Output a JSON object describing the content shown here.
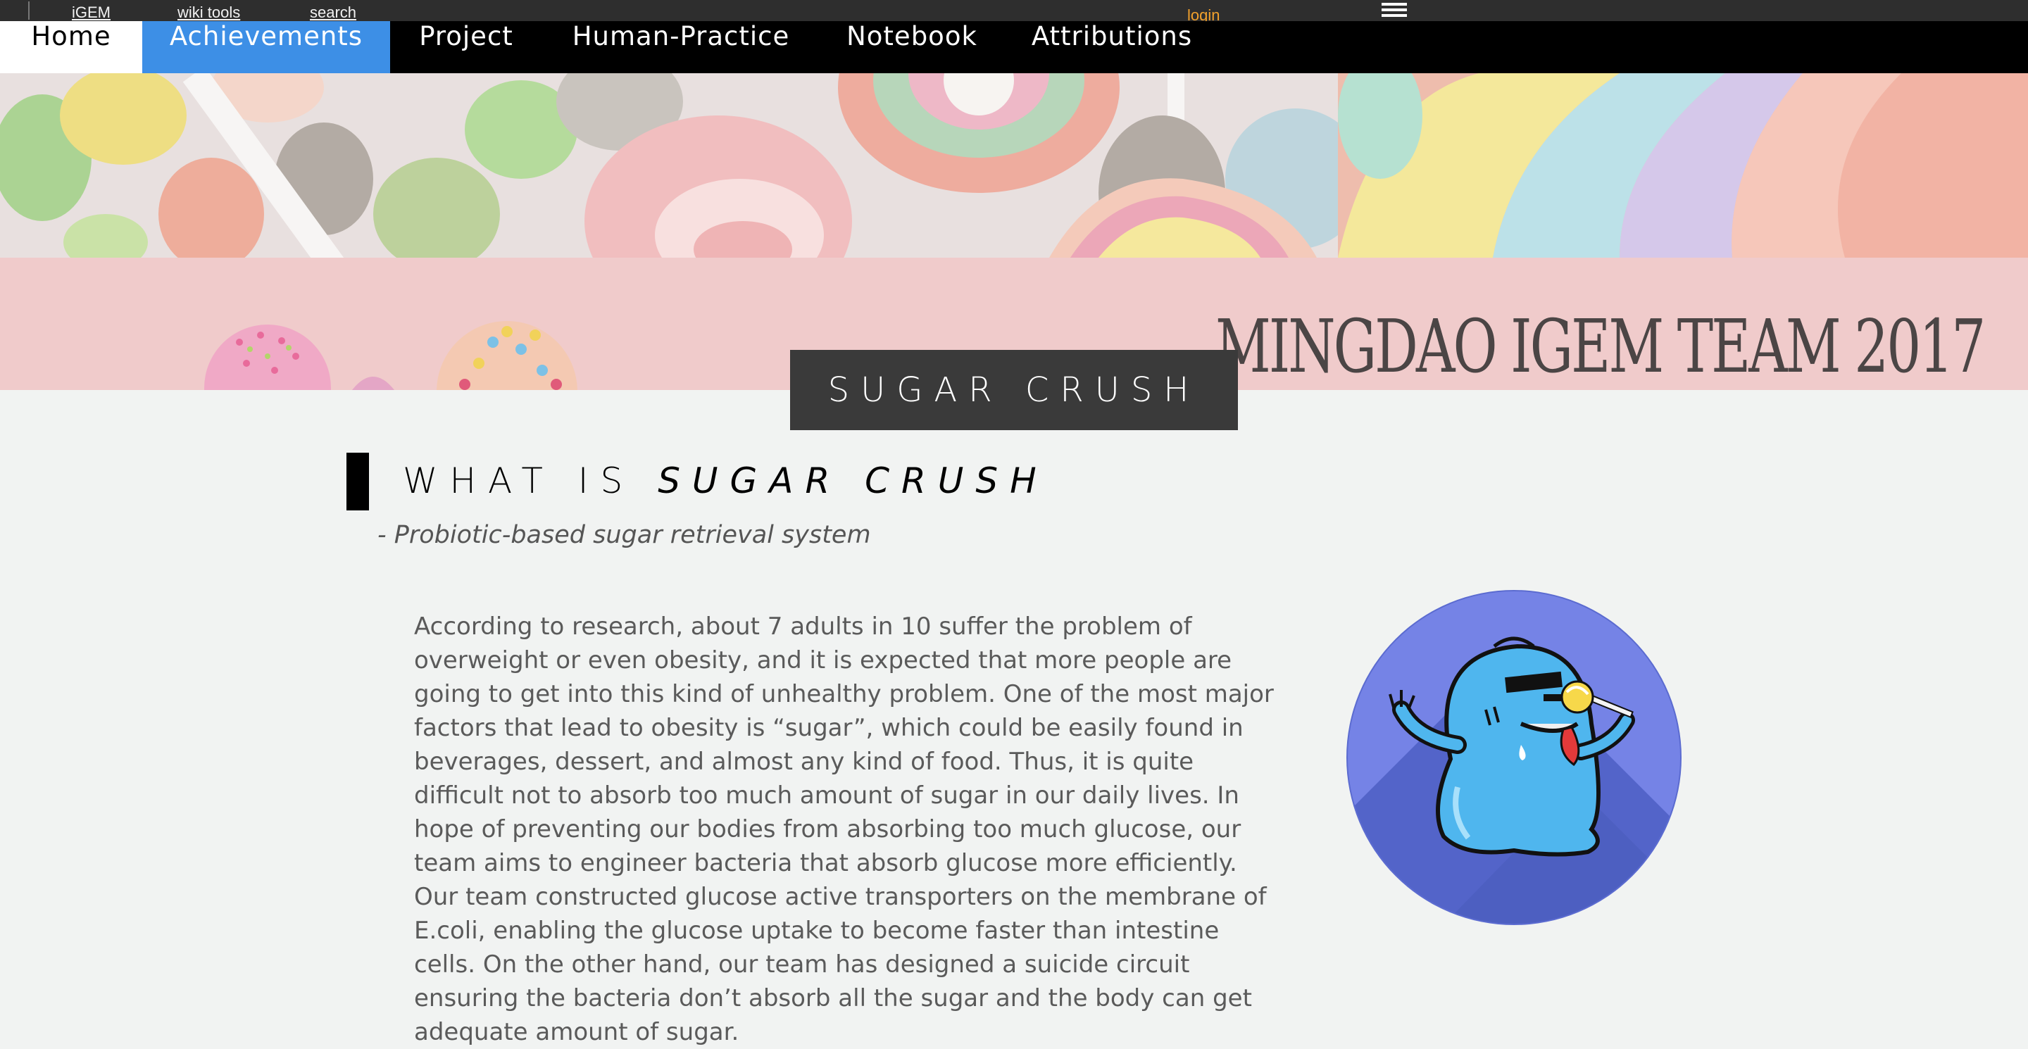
{
  "wikibar": {
    "links": [
      "iGEM",
      "wiki tools",
      "search"
    ],
    "login": "login",
    "menu_icon": "hamburger-menu-icon"
  },
  "nav": {
    "items": [
      "Home",
      "Achievements",
      "Project",
      "Human-Practice",
      "Notebook",
      "Attributions"
    ],
    "active": "Achievements"
  },
  "hero": {
    "team_title": "MINGDAO IGEM TEAM 2017",
    "banner": "SUGAR CRUSH"
  },
  "section": {
    "heading_prefix": "WHAT IS",
    "heading_emphasis": "SUGAR CRUSH",
    "subtitle": "- Probiotic-based sugar retrieval system",
    "paragraph": "According to research, about 7 adults in 10 suffer the problem of overweight or even obesity, and it is expected that more people are going to get into this kind of unhealthy problem. One of the most major factors that lead to obesity is “sugar”, which could be easily found in beverages, dessert, and almost any kind of food. Thus, it is quite difficult not to absorb too much amount of sugar in our daily lives. In hope of preventing our bodies from absorbing too much glucose, our team aims to engineer bacteria that absorb glucose more efficiently. Our team constructed glucose active transporters on the membrane of E.coli, enabling the glucose uptake to become faster than intestine cells. On the other hand, our team has designed a suicide circuit ensuring the bacteria don’t absorb all the sugar and the body can get adequate amount of sugar."
  },
  "colors": {
    "nav_bg": "#000000",
    "nav_active": "#3d8fe6",
    "login": "#f2a12c",
    "pink_band": "#f0cbcb",
    "banner_bg": "#3a3a3a",
    "page_bg": "#f1f3f2",
    "mascot_circle": "#7583e6"
  }
}
